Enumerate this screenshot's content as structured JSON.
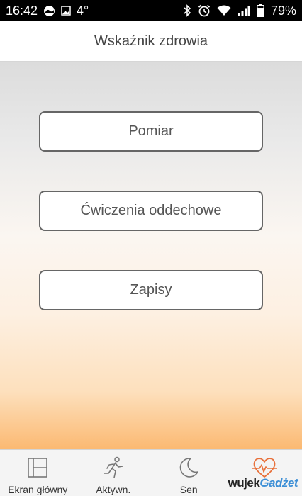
{
  "status_bar": {
    "time": "16:42",
    "temperature": "4°",
    "battery": "79%",
    "battery_level": 0.79,
    "icons": [
      "weather-icon",
      "image-icon",
      "bluetooth-icon",
      "alarm-icon",
      "wifi-icon",
      "signal-icon",
      "battery-icon"
    ]
  },
  "header": {
    "title": "Wskaźnik zdrowia"
  },
  "menu": {
    "items": [
      {
        "label": "Pomiar"
      },
      {
        "label": "Ćwiczenia oddechowe"
      },
      {
        "label": "Zapisy"
      }
    ]
  },
  "bottom_nav": {
    "items": [
      {
        "label": "Ekran główny",
        "icon": "home-layout-icon"
      },
      {
        "label": "Aktywn.",
        "icon": "runner-icon"
      },
      {
        "label": "Sen",
        "icon": "moon-icon"
      },
      {
        "label": "",
        "icon": "heart-pulse-icon",
        "active": true
      }
    ]
  },
  "watermark": {
    "part1": "wujek",
    "part2": "Gadżet"
  },
  "colors": {
    "accent": "#e8703a",
    "button_border": "#666666",
    "gradient_bottom": "#fbb972"
  }
}
